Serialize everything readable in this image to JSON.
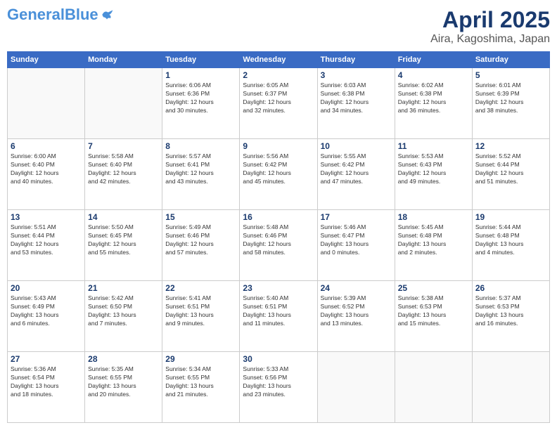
{
  "header": {
    "logo_line1": "General",
    "logo_line2": "Blue",
    "title": "April 2025",
    "subtitle": "Aira, Kagoshima, Japan"
  },
  "weekdays": [
    "Sunday",
    "Monday",
    "Tuesday",
    "Wednesday",
    "Thursday",
    "Friday",
    "Saturday"
  ],
  "weeks": [
    [
      {
        "day": "",
        "info": ""
      },
      {
        "day": "",
        "info": ""
      },
      {
        "day": "1",
        "info": "Sunrise: 6:06 AM\nSunset: 6:36 PM\nDaylight: 12 hours\nand 30 minutes."
      },
      {
        "day": "2",
        "info": "Sunrise: 6:05 AM\nSunset: 6:37 PM\nDaylight: 12 hours\nand 32 minutes."
      },
      {
        "day": "3",
        "info": "Sunrise: 6:03 AM\nSunset: 6:38 PM\nDaylight: 12 hours\nand 34 minutes."
      },
      {
        "day": "4",
        "info": "Sunrise: 6:02 AM\nSunset: 6:38 PM\nDaylight: 12 hours\nand 36 minutes."
      },
      {
        "day": "5",
        "info": "Sunrise: 6:01 AM\nSunset: 6:39 PM\nDaylight: 12 hours\nand 38 minutes."
      }
    ],
    [
      {
        "day": "6",
        "info": "Sunrise: 6:00 AM\nSunset: 6:40 PM\nDaylight: 12 hours\nand 40 minutes."
      },
      {
        "day": "7",
        "info": "Sunrise: 5:58 AM\nSunset: 6:40 PM\nDaylight: 12 hours\nand 42 minutes."
      },
      {
        "day": "8",
        "info": "Sunrise: 5:57 AM\nSunset: 6:41 PM\nDaylight: 12 hours\nand 43 minutes."
      },
      {
        "day": "9",
        "info": "Sunrise: 5:56 AM\nSunset: 6:42 PM\nDaylight: 12 hours\nand 45 minutes."
      },
      {
        "day": "10",
        "info": "Sunrise: 5:55 AM\nSunset: 6:42 PM\nDaylight: 12 hours\nand 47 minutes."
      },
      {
        "day": "11",
        "info": "Sunrise: 5:53 AM\nSunset: 6:43 PM\nDaylight: 12 hours\nand 49 minutes."
      },
      {
        "day": "12",
        "info": "Sunrise: 5:52 AM\nSunset: 6:44 PM\nDaylight: 12 hours\nand 51 minutes."
      }
    ],
    [
      {
        "day": "13",
        "info": "Sunrise: 5:51 AM\nSunset: 6:44 PM\nDaylight: 12 hours\nand 53 minutes."
      },
      {
        "day": "14",
        "info": "Sunrise: 5:50 AM\nSunset: 6:45 PM\nDaylight: 12 hours\nand 55 minutes."
      },
      {
        "day": "15",
        "info": "Sunrise: 5:49 AM\nSunset: 6:46 PM\nDaylight: 12 hours\nand 57 minutes."
      },
      {
        "day": "16",
        "info": "Sunrise: 5:48 AM\nSunset: 6:46 PM\nDaylight: 12 hours\nand 58 minutes."
      },
      {
        "day": "17",
        "info": "Sunrise: 5:46 AM\nSunset: 6:47 PM\nDaylight: 13 hours\nand 0 minutes."
      },
      {
        "day": "18",
        "info": "Sunrise: 5:45 AM\nSunset: 6:48 PM\nDaylight: 13 hours\nand 2 minutes."
      },
      {
        "day": "19",
        "info": "Sunrise: 5:44 AM\nSunset: 6:48 PM\nDaylight: 13 hours\nand 4 minutes."
      }
    ],
    [
      {
        "day": "20",
        "info": "Sunrise: 5:43 AM\nSunset: 6:49 PM\nDaylight: 13 hours\nand 6 minutes."
      },
      {
        "day": "21",
        "info": "Sunrise: 5:42 AM\nSunset: 6:50 PM\nDaylight: 13 hours\nand 7 minutes."
      },
      {
        "day": "22",
        "info": "Sunrise: 5:41 AM\nSunset: 6:51 PM\nDaylight: 13 hours\nand 9 minutes."
      },
      {
        "day": "23",
        "info": "Sunrise: 5:40 AM\nSunset: 6:51 PM\nDaylight: 13 hours\nand 11 minutes."
      },
      {
        "day": "24",
        "info": "Sunrise: 5:39 AM\nSunset: 6:52 PM\nDaylight: 13 hours\nand 13 minutes."
      },
      {
        "day": "25",
        "info": "Sunrise: 5:38 AM\nSunset: 6:53 PM\nDaylight: 13 hours\nand 15 minutes."
      },
      {
        "day": "26",
        "info": "Sunrise: 5:37 AM\nSunset: 6:53 PM\nDaylight: 13 hours\nand 16 minutes."
      }
    ],
    [
      {
        "day": "27",
        "info": "Sunrise: 5:36 AM\nSunset: 6:54 PM\nDaylight: 13 hours\nand 18 minutes."
      },
      {
        "day": "28",
        "info": "Sunrise: 5:35 AM\nSunset: 6:55 PM\nDaylight: 13 hours\nand 20 minutes."
      },
      {
        "day": "29",
        "info": "Sunrise: 5:34 AM\nSunset: 6:55 PM\nDaylight: 13 hours\nand 21 minutes."
      },
      {
        "day": "30",
        "info": "Sunrise: 5:33 AM\nSunset: 6:56 PM\nDaylight: 13 hours\nand 23 minutes."
      },
      {
        "day": "",
        "info": ""
      },
      {
        "day": "",
        "info": ""
      },
      {
        "day": "",
        "info": ""
      }
    ]
  ]
}
